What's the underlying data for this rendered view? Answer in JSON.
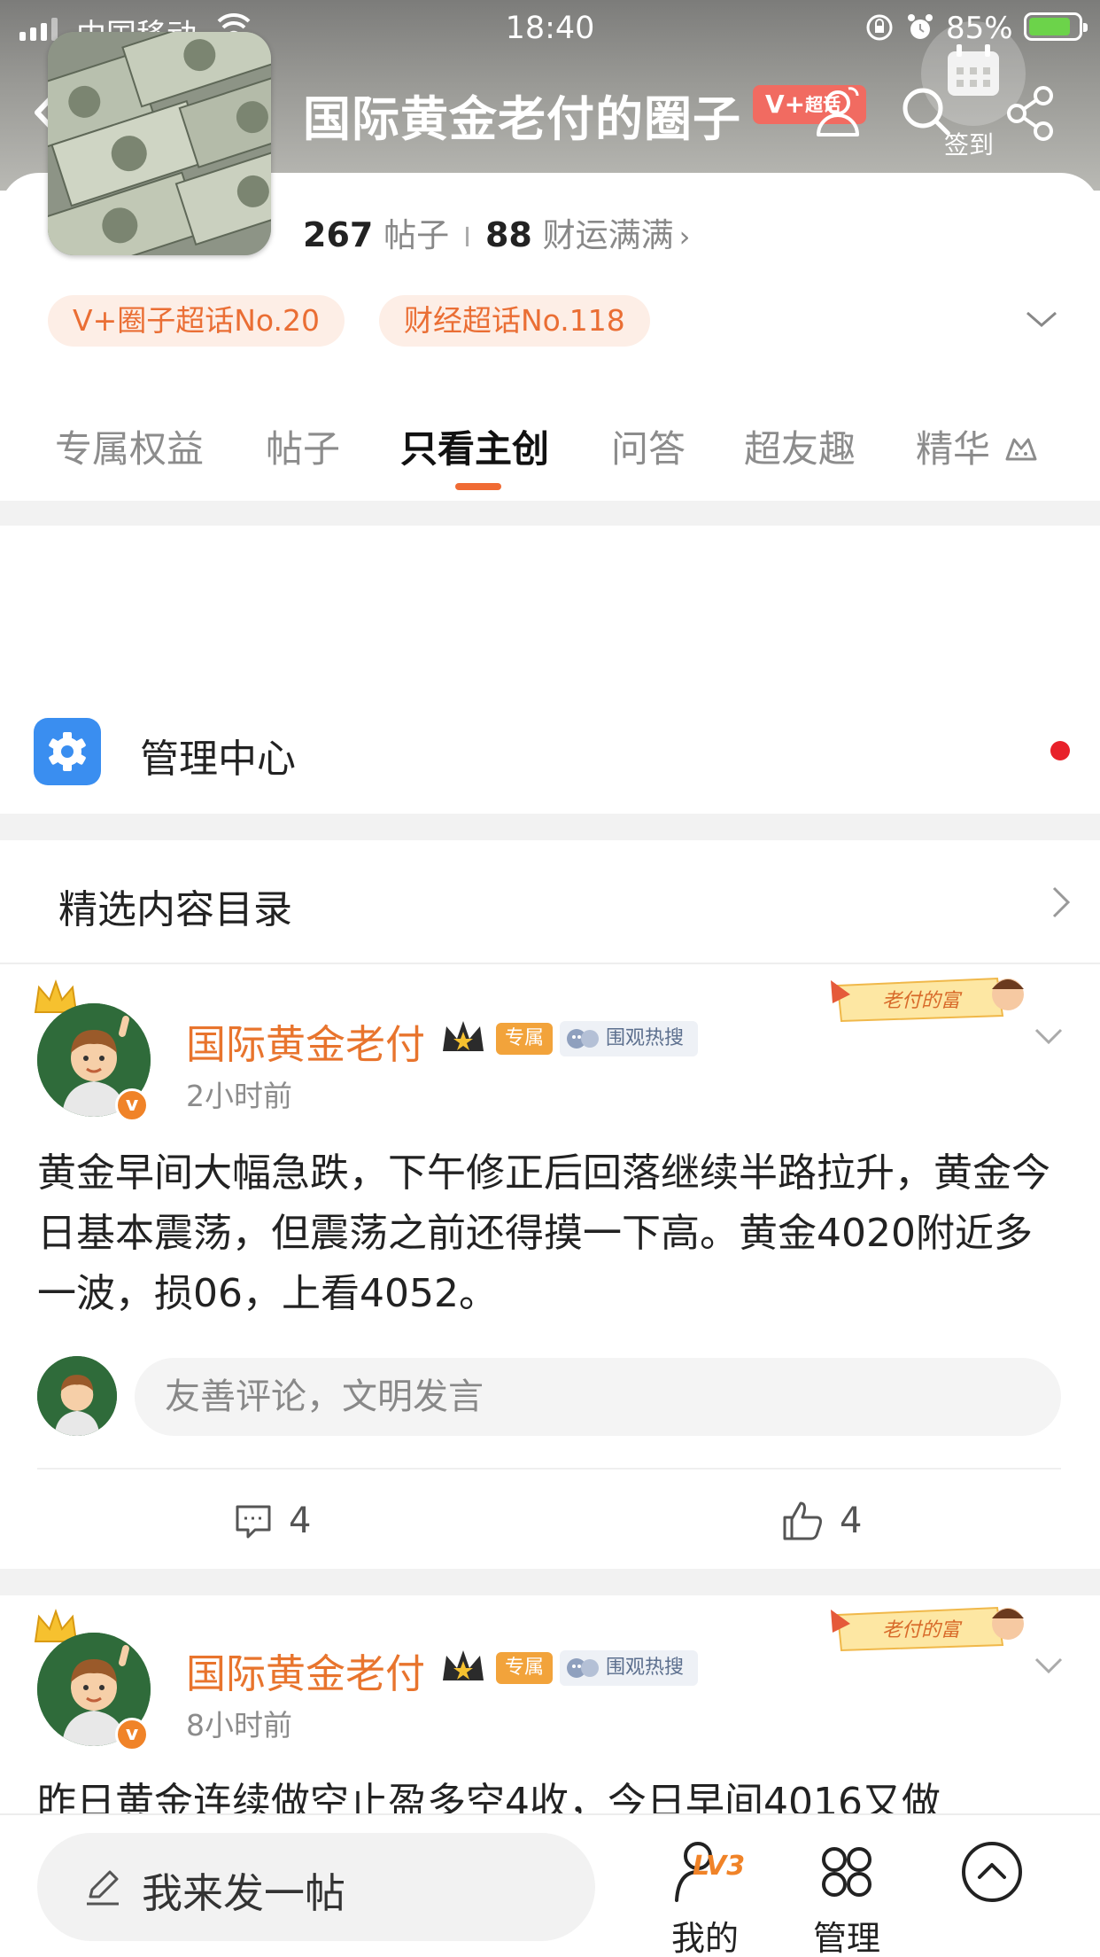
{
  "status_bar": {
    "carrier": "中国移动",
    "time": "18:40",
    "battery_percent": "85%",
    "battery_level": 0.85
  },
  "header": {
    "circle_name": "国际黄金老付的圈子",
    "badge_text": "V+",
    "badge_sub": "超话",
    "checkin_label": "签到",
    "icons": [
      "back-icon",
      "members-icon",
      "search-icon",
      "calendar-icon",
      "share-icon"
    ]
  },
  "stats": {
    "posts_count": "267",
    "posts_label": "帖子",
    "fortune_count": "88",
    "fortune_label": "财运满满"
  },
  "tags": [
    "V+圈子超话No.20",
    "财经超话No.118"
  ],
  "tabs": [
    {
      "label": "专属权益",
      "active": false
    },
    {
      "label": "帖子",
      "active": false
    },
    {
      "label": "只看主创",
      "active": true
    },
    {
      "label": "问答",
      "active": false
    },
    {
      "label": "超友趣",
      "active": false
    },
    {
      "label": "精华",
      "active": false
    }
  ],
  "manage": {
    "label": "管理中心"
  },
  "catalog": {
    "label": "精选内容目录"
  },
  "posts": [
    {
      "author": "国际黄金老付",
      "badge_exclusive": "专属",
      "badge_hot": "围观热搜",
      "banner_text": "老付的富",
      "time": "2小时前",
      "body": "黄金早间大幅急跌，下午修正后回落继续半路拉升，黄金今日基本震荡，但震荡之前还得摸一下高。黄金4020附近多一波，损06，上看4052。",
      "comment_placeholder": "友善评论，文明发言",
      "comments": "4",
      "likes": "4"
    },
    {
      "author": "国际黄金老付",
      "badge_exclusive": "专属",
      "badge_hot": "围观热搜",
      "banner_text": "老付的富",
      "time": "8小时前",
      "body": "昨日黄金连续做空止盈多空4收，今日早间4016又做"
    }
  ],
  "bottom_bar": {
    "compose_label": "我来发一帖",
    "nav": [
      {
        "label": "我的",
        "level": "LV3"
      },
      {
        "label": "管理"
      },
      {
        "label": ""
      }
    ]
  },
  "colors": {
    "accent": "#f06b34",
    "author": "#e8742d",
    "tag_bg": "#fdeee6",
    "manage_icon": "#3a8ef0",
    "alert_dot": "#e8212a"
  }
}
